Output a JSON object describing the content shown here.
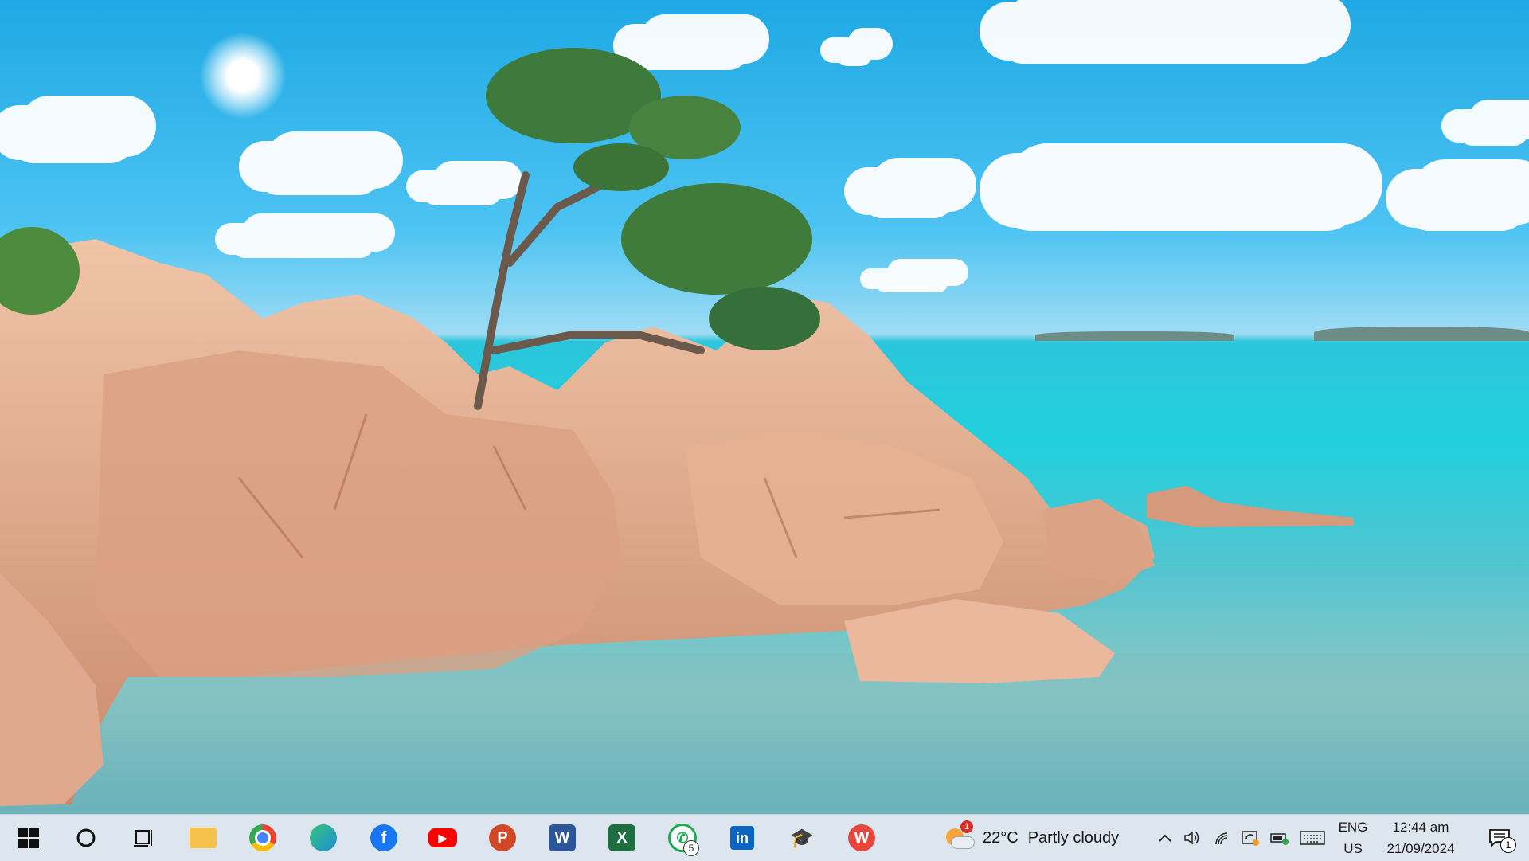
{
  "desktop": {
    "wallpaper": "rocky-coast-sea-wallpaper",
    "colors": {
      "sky": "#3cb8ee",
      "sea": "#22d0dc",
      "rock": "#e3ae93"
    }
  },
  "taskbar": {
    "start_icon": "windows-logo-icon",
    "search_icon": "cortana-circle-icon",
    "task_view_icon": "task-view-icon",
    "apps": [
      {
        "name": "File Explorer",
        "icon": "folder-icon",
        "color": "#f4c24b",
        "glyph": ""
      },
      {
        "name": "Google Chrome",
        "icon": "chrome-icon",
        "color": "#34a853",
        "glyph": ""
      },
      {
        "name": "Microsoft Edge",
        "icon": "edge-icon",
        "color": "#1b8fd6",
        "glyph": ""
      },
      {
        "name": "Facebook",
        "icon": "facebook-icon",
        "color": "#1877f2",
        "glyph": "f"
      },
      {
        "name": "YouTube",
        "icon": "youtube-icon",
        "color": "#ff0000",
        "glyph": "▶"
      },
      {
        "name": "PowerPoint",
        "icon": "powerpoint-icon",
        "color": "#d24726",
        "glyph": "P"
      },
      {
        "name": "Word",
        "icon": "word-icon",
        "color": "#2b579a",
        "glyph": "W"
      },
      {
        "name": "Excel",
        "icon": "excel-icon",
        "color": "#1d6f42",
        "glyph": "X"
      },
      {
        "name": "WhatsApp",
        "icon": "whatsapp-icon",
        "color": "#25d366",
        "glyph": "✆",
        "badge": "5"
      },
      {
        "name": "LinkedIn",
        "icon": "linkedin-icon",
        "color": "#0a66c2",
        "glyph": "in"
      },
      {
        "name": "Graduation",
        "icon": "graduation-cap-icon",
        "color": "#222222",
        "glyph": "🎓"
      },
      {
        "name": "WPS Office",
        "icon": "wps-icon",
        "color": "#e8453c",
        "glyph": "W"
      }
    ],
    "weather": {
      "icon": "partly-cloudy-icon",
      "badge": "1",
      "temp": "22°C",
      "condition": "Partly cloudy"
    },
    "tray": {
      "chevron_icon": "chevron-up-icon",
      "volume_icon": "speaker-icon",
      "network_icon": "wifi-icon",
      "sync_icon": "sync-icon",
      "battery_icon": "battery-icon",
      "keyboard_icon": "keyboard-icon",
      "language_top": "ENG",
      "language_bottom": "US",
      "time": "12:44 am",
      "date": "21/09/2024",
      "notification_icon": "notification-icon",
      "notification_count": "1"
    }
  }
}
